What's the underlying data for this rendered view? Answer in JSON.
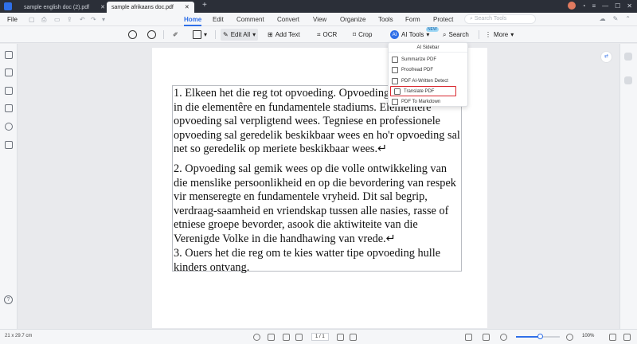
{
  "tabs": [
    {
      "label": "sample english doc (2).pdf",
      "active": false
    },
    {
      "label": "sample afrikaans doc.pdf",
      "active": true
    }
  ],
  "menubar": {
    "file": "File",
    "items": [
      "Home",
      "Edit",
      "Comment",
      "Convert",
      "View",
      "Organize",
      "Tools",
      "Form",
      "Protect"
    ],
    "active": "Home",
    "search_placeholder": "Search Tools"
  },
  "toolbar": {
    "edit_all": "Edit All",
    "add_text": "Add Text",
    "ocr": "OCR",
    "crop": "Crop",
    "ai_tools": "AI Tools",
    "ai_glyph": "AI",
    "new_badge": "NEW",
    "search": "Search",
    "more": "More"
  },
  "dropdown": {
    "header": "AI Sidebar",
    "items": [
      "Summarize PDF",
      "Proofread PDF",
      "PDF AI-Written Detect",
      "Translate PDF",
      "PDF To Markdown"
    ],
    "highlighted": "Translate PDF"
  },
  "document": {
    "paragraphs": [
      "1. Elkeen het die reg tot opvoeding. Opvoeding sal ten minste in die elementêre en fundamentele stadiums. Elementêre opvoeding sal verpligtend wees. Tegniese en professionele opvoeding sal geredelik beskikbaar wees en ho'r opvoeding sal net so geredelik op meriete beskikbaar wees.↵",
      "2. Opvoeding sal gemik wees op die volle ontwikkeling van die menslike persoonlikheid en op die bevordering van respek vir menseregte en fundamentele vryheid. Dit sal begrip, verdraag-saamheid en vriendskap tussen alle nasies, rasse of etniese groepe bevorder, asook die aktiwiteite van die Verenigde Volke in die handhawing van vrede.↵",
      "3. Ouers het die reg om te kies watter tipe opvoeding hulle kinders ontvang."
    ]
  },
  "statusbar": {
    "page_size": "21 x 29.7 cm",
    "page_number": "1 / 1",
    "zoom": "100%",
    "zoom_level": 0.55
  },
  "colors": {
    "accent": "#2f6fe8",
    "highlight_border": "#d9272e"
  }
}
